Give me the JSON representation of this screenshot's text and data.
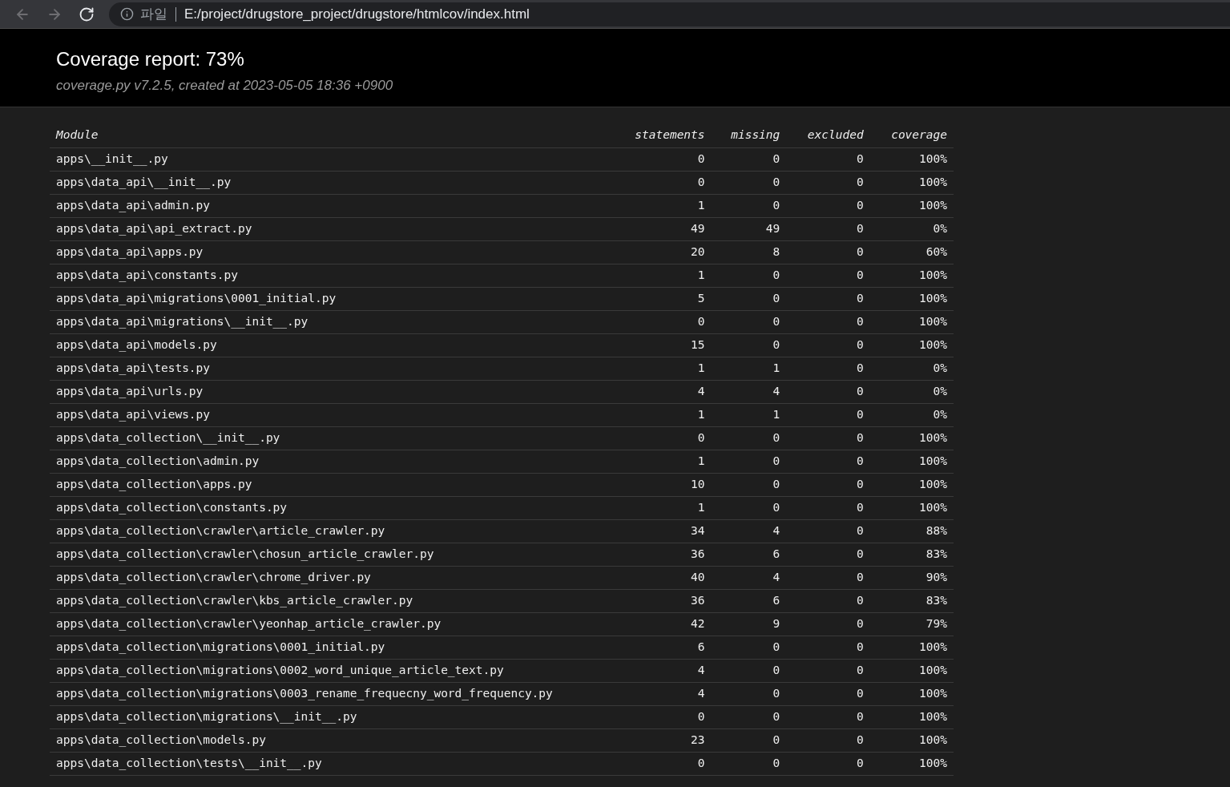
{
  "browser": {
    "nav": [
      {
        "kind": "back",
        "disabled": true
      },
      {
        "kind": "forward",
        "disabled": true
      },
      {
        "kind": "reload",
        "disabled": false
      }
    ],
    "scheme_label": "파일",
    "url": "E:/project/drugstore_project/drugstore/htmlcov/index.html"
  },
  "header": {
    "title": "Coverage report: 73%",
    "subtitle": "coverage.py v7.2.5, created at 2023-05-05 18:36 +0900"
  },
  "table": {
    "columns": [
      "Module",
      "statements",
      "missing",
      "excluded",
      "coverage"
    ],
    "rows": [
      [
        "apps\\__init__.py",
        "0",
        "0",
        "0",
        "100%"
      ],
      [
        "apps\\data_api\\__init__.py",
        "0",
        "0",
        "0",
        "100%"
      ],
      [
        "apps\\data_api\\admin.py",
        "1",
        "0",
        "0",
        "100%"
      ],
      [
        "apps\\data_api\\api_extract.py",
        "49",
        "49",
        "0",
        "0%"
      ],
      [
        "apps\\data_api\\apps.py",
        "20",
        "8",
        "0",
        "60%"
      ],
      [
        "apps\\data_api\\constants.py",
        "1",
        "0",
        "0",
        "100%"
      ],
      [
        "apps\\data_api\\migrations\\0001_initial.py",
        "5",
        "0",
        "0",
        "100%"
      ],
      [
        "apps\\data_api\\migrations\\__init__.py",
        "0",
        "0",
        "0",
        "100%"
      ],
      [
        "apps\\data_api\\models.py",
        "15",
        "0",
        "0",
        "100%"
      ],
      [
        "apps\\data_api\\tests.py",
        "1",
        "1",
        "0",
        "0%"
      ],
      [
        "apps\\data_api\\urls.py",
        "4",
        "4",
        "0",
        "0%"
      ],
      [
        "apps\\data_api\\views.py",
        "1",
        "1",
        "0",
        "0%"
      ],
      [
        "apps\\data_collection\\__init__.py",
        "0",
        "0",
        "0",
        "100%"
      ],
      [
        "apps\\data_collection\\admin.py",
        "1",
        "0",
        "0",
        "100%"
      ],
      [
        "apps\\data_collection\\apps.py",
        "10",
        "0",
        "0",
        "100%"
      ],
      [
        "apps\\data_collection\\constants.py",
        "1",
        "0",
        "0",
        "100%"
      ],
      [
        "apps\\data_collection\\crawler\\article_crawler.py",
        "34",
        "4",
        "0",
        "88%"
      ],
      [
        "apps\\data_collection\\crawler\\chosun_article_crawler.py",
        "36",
        "6",
        "0",
        "83%"
      ],
      [
        "apps\\data_collection\\crawler\\chrome_driver.py",
        "40",
        "4",
        "0",
        "90%"
      ],
      [
        "apps\\data_collection\\crawler\\kbs_article_crawler.py",
        "36",
        "6",
        "0",
        "83%"
      ],
      [
        "apps\\data_collection\\crawler\\yeonhap_article_crawler.py",
        "42",
        "9",
        "0",
        "79%"
      ],
      [
        "apps\\data_collection\\migrations\\0001_initial.py",
        "6",
        "0",
        "0",
        "100%"
      ],
      [
        "apps\\data_collection\\migrations\\0002_word_unique_article_text.py",
        "4",
        "0",
        "0",
        "100%"
      ],
      [
        "apps\\data_collection\\migrations\\0003_rename_frequecny_word_frequency.py",
        "4",
        "0",
        "0",
        "100%"
      ],
      [
        "apps\\data_collection\\migrations\\__init__.py",
        "0",
        "0",
        "0",
        "100%"
      ],
      [
        "apps\\data_collection\\models.py",
        "23",
        "0",
        "0",
        "100%"
      ],
      [
        "apps\\data_collection\\tests\\__init__.py",
        "0",
        "0",
        "0",
        "100%"
      ]
    ]
  }
}
